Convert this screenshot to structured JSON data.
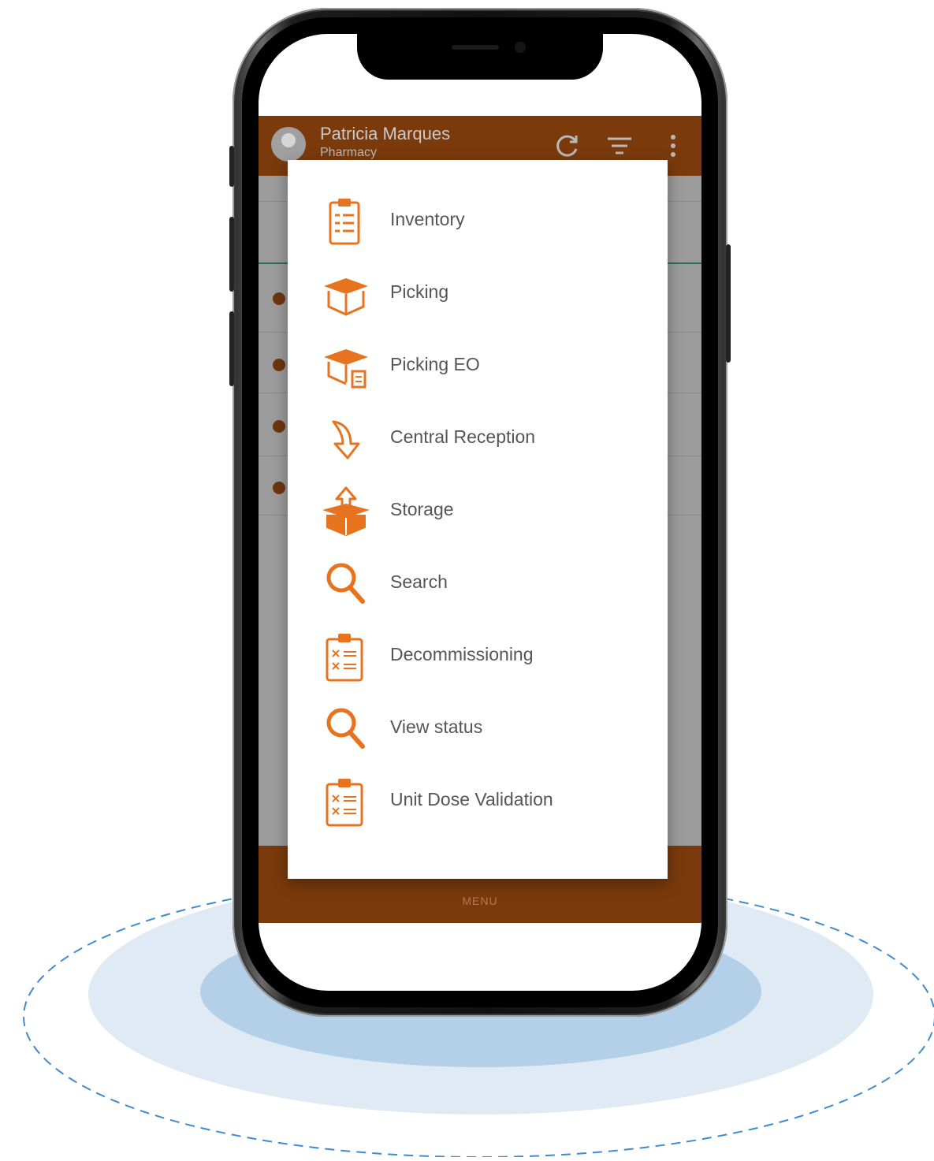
{
  "header": {
    "user_name": "Patricia Marques",
    "user_role": "Pharmacy"
  },
  "menu": {
    "items": [
      {
        "label": "Inventory",
        "icon": "clipboard-list-icon"
      },
      {
        "label": "Picking",
        "icon": "open-box-icon"
      },
      {
        "label": "Picking EO",
        "icon": "open-box-document-icon"
      },
      {
        "label": "Central Reception",
        "icon": "curved-arrow-icon"
      },
      {
        "label": "Storage",
        "icon": "box-upload-icon"
      },
      {
        "label": "Search",
        "icon": "search-icon"
      },
      {
        "label": "Decommissioning",
        "icon": "clipboard-x-icon"
      },
      {
        "label": "View status",
        "icon": "search-icon"
      },
      {
        "label": "Unit Dose Validation",
        "icon": "clipboard-x-icon"
      }
    ]
  },
  "bottom_bar": {
    "label": "MENU"
  },
  "colors": {
    "accent": "#e8731e",
    "appbar": "#7a3a0c",
    "backdrop_light": "#dfeaf5",
    "backdrop_dark": "#b4cfe8",
    "dashed_ring": "#3f8bd0"
  }
}
